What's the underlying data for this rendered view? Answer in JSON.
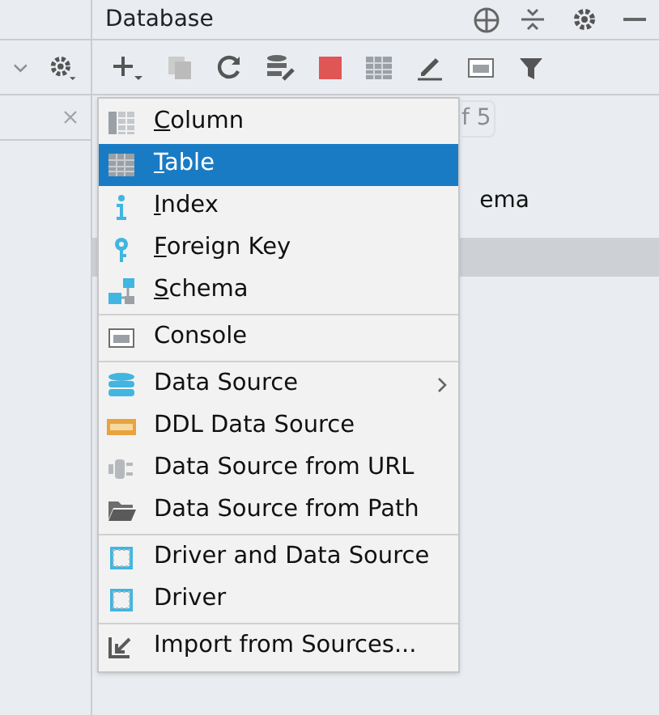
{
  "panel": {
    "title": "Database"
  },
  "background": {
    "counter": "f 5",
    "tree_text": "ema"
  },
  "menu": {
    "sections": [
      {
        "items": [
          {
            "kind": "column",
            "label": "Column",
            "selected": false,
            "underline_first": true
          },
          {
            "kind": "table",
            "label": "Table",
            "selected": true,
            "underline_first": true
          },
          {
            "kind": "index",
            "label": "Index",
            "selected": false,
            "underline_first": true
          },
          {
            "kind": "key",
            "label": "Foreign Key",
            "selected": false,
            "underline_first": true
          },
          {
            "kind": "schema",
            "label": "Schema",
            "selected": false,
            "underline_first": true
          }
        ]
      },
      {
        "items": [
          {
            "kind": "console",
            "label": "Console",
            "selected": false,
            "underline_first": false
          }
        ]
      },
      {
        "items": [
          {
            "kind": "datasource",
            "label": "Data Source",
            "selected": false,
            "underline_first": false,
            "submenu": true
          },
          {
            "kind": "ddl",
            "label": "DDL Data Source",
            "selected": false,
            "underline_first": false
          },
          {
            "kind": "url",
            "label": "Data Source from URL",
            "selected": false,
            "underline_first": false
          },
          {
            "kind": "folder",
            "label": "Data Source from Path",
            "selected": false,
            "underline_first": false
          }
        ]
      },
      {
        "items": [
          {
            "kind": "driver",
            "label": "Driver and Data Source",
            "selected": false,
            "underline_first": false
          },
          {
            "kind": "driver",
            "label": "Driver",
            "selected": false,
            "underline_first": false
          }
        ]
      },
      {
        "items": [
          {
            "kind": "import",
            "label": "Import from Sources...",
            "selected": false,
            "underline_first": false
          }
        ]
      }
    ]
  }
}
